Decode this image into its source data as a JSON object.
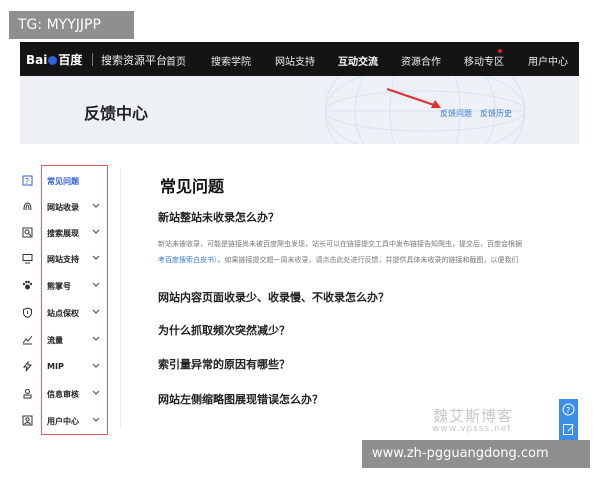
{
  "overlay": {
    "tg_label": "TG: MYYJJPP",
    "bottom_url": "www.zh-pgguangdong.com",
    "site_watermark_cn": "魏艾斯博客",
    "site_watermark_url": "www.vpsss.net"
  },
  "topnav": {
    "logo_text_a": "Bai",
    "logo_text_b": "百度",
    "platform": "搜索资源平台",
    "items": [
      "首页",
      "搜索学院",
      "网站支持",
      "互动交流",
      "资源合作",
      "移动专区",
      "用户中心"
    ],
    "active_item": "互动交流"
  },
  "banner": {
    "title": "反馈中心",
    "link_feedback": "反馈问题",
    "link_history": "反馈历史"
  },
  "sidebar": {
    "items": [
      {
        "label": "常见问题",
        "icon": "question-icon"
      },
      {
        "label": "网站收录",
        "icon": "fingerprint-icon"
      },
      {
        "label": "搜索展现",
        "icon": "search-display-icon"
      },
      {
        "label": "网站支持",
        "icon": "monitor-icon"
      },
      {
        "label": "熊掌号",
        "icon": "paw-icon"
      },
      {
        "label": "站点保权",
        "icon": "shield-icon"
      },
      {
        "label": "流量",
        "icon": "chart-icon"
      },
      {
        "label": "MIP",
        "icon": "lightning-icon"
      },
      {
        "label": "信息审核",
        "icon": "user-check-icon"
      },
      {
        "label": "用户中心",
        "icon": "user-card-icon"
      }
    ]
  },
  "main": {
    "title": "常见问题",
    "questions": [
      {
        "q": "新站整站未收录怎么办？",
        "answer_line1": "新站未被收录，可能是链接尚未被百度爬虫发现，站长可以在链接提交工具中发布链接告知爬虫，提交后，百度会根据",
        "answer_line2_link": "考百度搜索白皮书",
        "answer_line2_rest": "）。如果链接提交超一周未收录，请点击此处进行反馈，并提供具体未收录的链接和截图，以便我们"
      },
      {
        "q": "网站内容页面收录少、收录慢、不收录怎么办？"
      },
      {
        "q": "为什么抓取频次突然减少？"
      },
      {
        "q": "索引量异常的原因有哪些？"
      },
      {
        "q": "网站左侧缩略图展现错误怎么办？"
      }
    ]
  },
  "right_tools": {
    "help_icon": "question-icon",
    "feedback_icon": "edit-icon"
  }
}
